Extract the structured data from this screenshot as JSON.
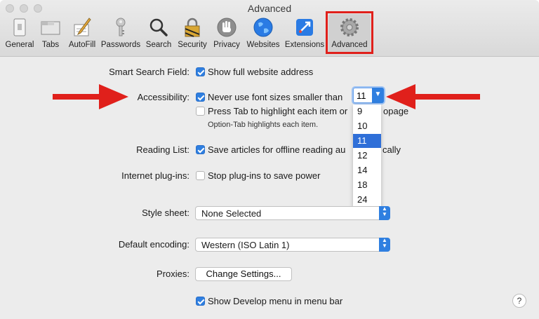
{
  "window": {
    "title": "Advanced"
  },
  "toolbar": {
    "items": [
      {
        "label": "General",
        "icon": "general-icon"
      },
      {
        "label": "Tabs",
        "icon": "tabs-icon"
      },
      {
        "label": "AutoFill",
        "icon": "autofill-icon"
      },
      {
        "label": "Passwords",
        "icon": "key-icon"
      },
      {
        "label": "Search",
        "icon": "magnifier-icon"
      },
      {
        "label": "Security",
        "icon": "lock-icon"
      },
      {
        "label": "Privacy",
        "icon": "hand-icon"
      },
      {
        "label": "Websites",
        "icon": "globe-icon"
      },
      {
        "label": "Extensions",
        "icon": "extensions-icon"
      },
      {
        "label": "Advanced",
        "icon": "gear-icon"
      }
    ],
    "selected": "Advanced"
  },
  "settings": {
    "smart_search_label": "Smart Search Field:",
    "smart_search_option": "Show full website address",
    "accessibility_label": "Accessibility:",
    "font_size_option": "Never use font sizes smaller than",
    "font_size_value": "11",
    "font_size_options": [
      "9",
      "10",
      "11",
      "12",
      "14",
      "18",
      "24"
    ],
    "tab_highlight_option_prefix": "Press Tab to highlight each item or",
    "tab_highlight_option_suffix": "opage",
    "tab_highlight_hint": "Option-Tab highlights each item.",
    "reading_list_label": "Reading List:",
    "reading_list_option_prefix": "Save articles for offline reading au",
    "reading_list_option_suffix": "cally",
    "plugins_label": "Internet plug-ins:",
    "plugins_option": "Stop plug-ins to save power",
    "stylesheet_label": "Style sheet:",
    "stylesheet_value": "None Selected",
    "encoding_label": "Default encoding:",
    "encoding_value": "Western (ISO Latin 1)",
    "proxies_label": "Proxies:",
    "proxies_button": "Change Settings...",
    "develop_menu_option": "Show Develop menu in menu bar",
    "help_label": "?"
  },
  "colors": {
    "accent": "#2f7fe0",
    "annotation": "#e0201b"
  }
}
